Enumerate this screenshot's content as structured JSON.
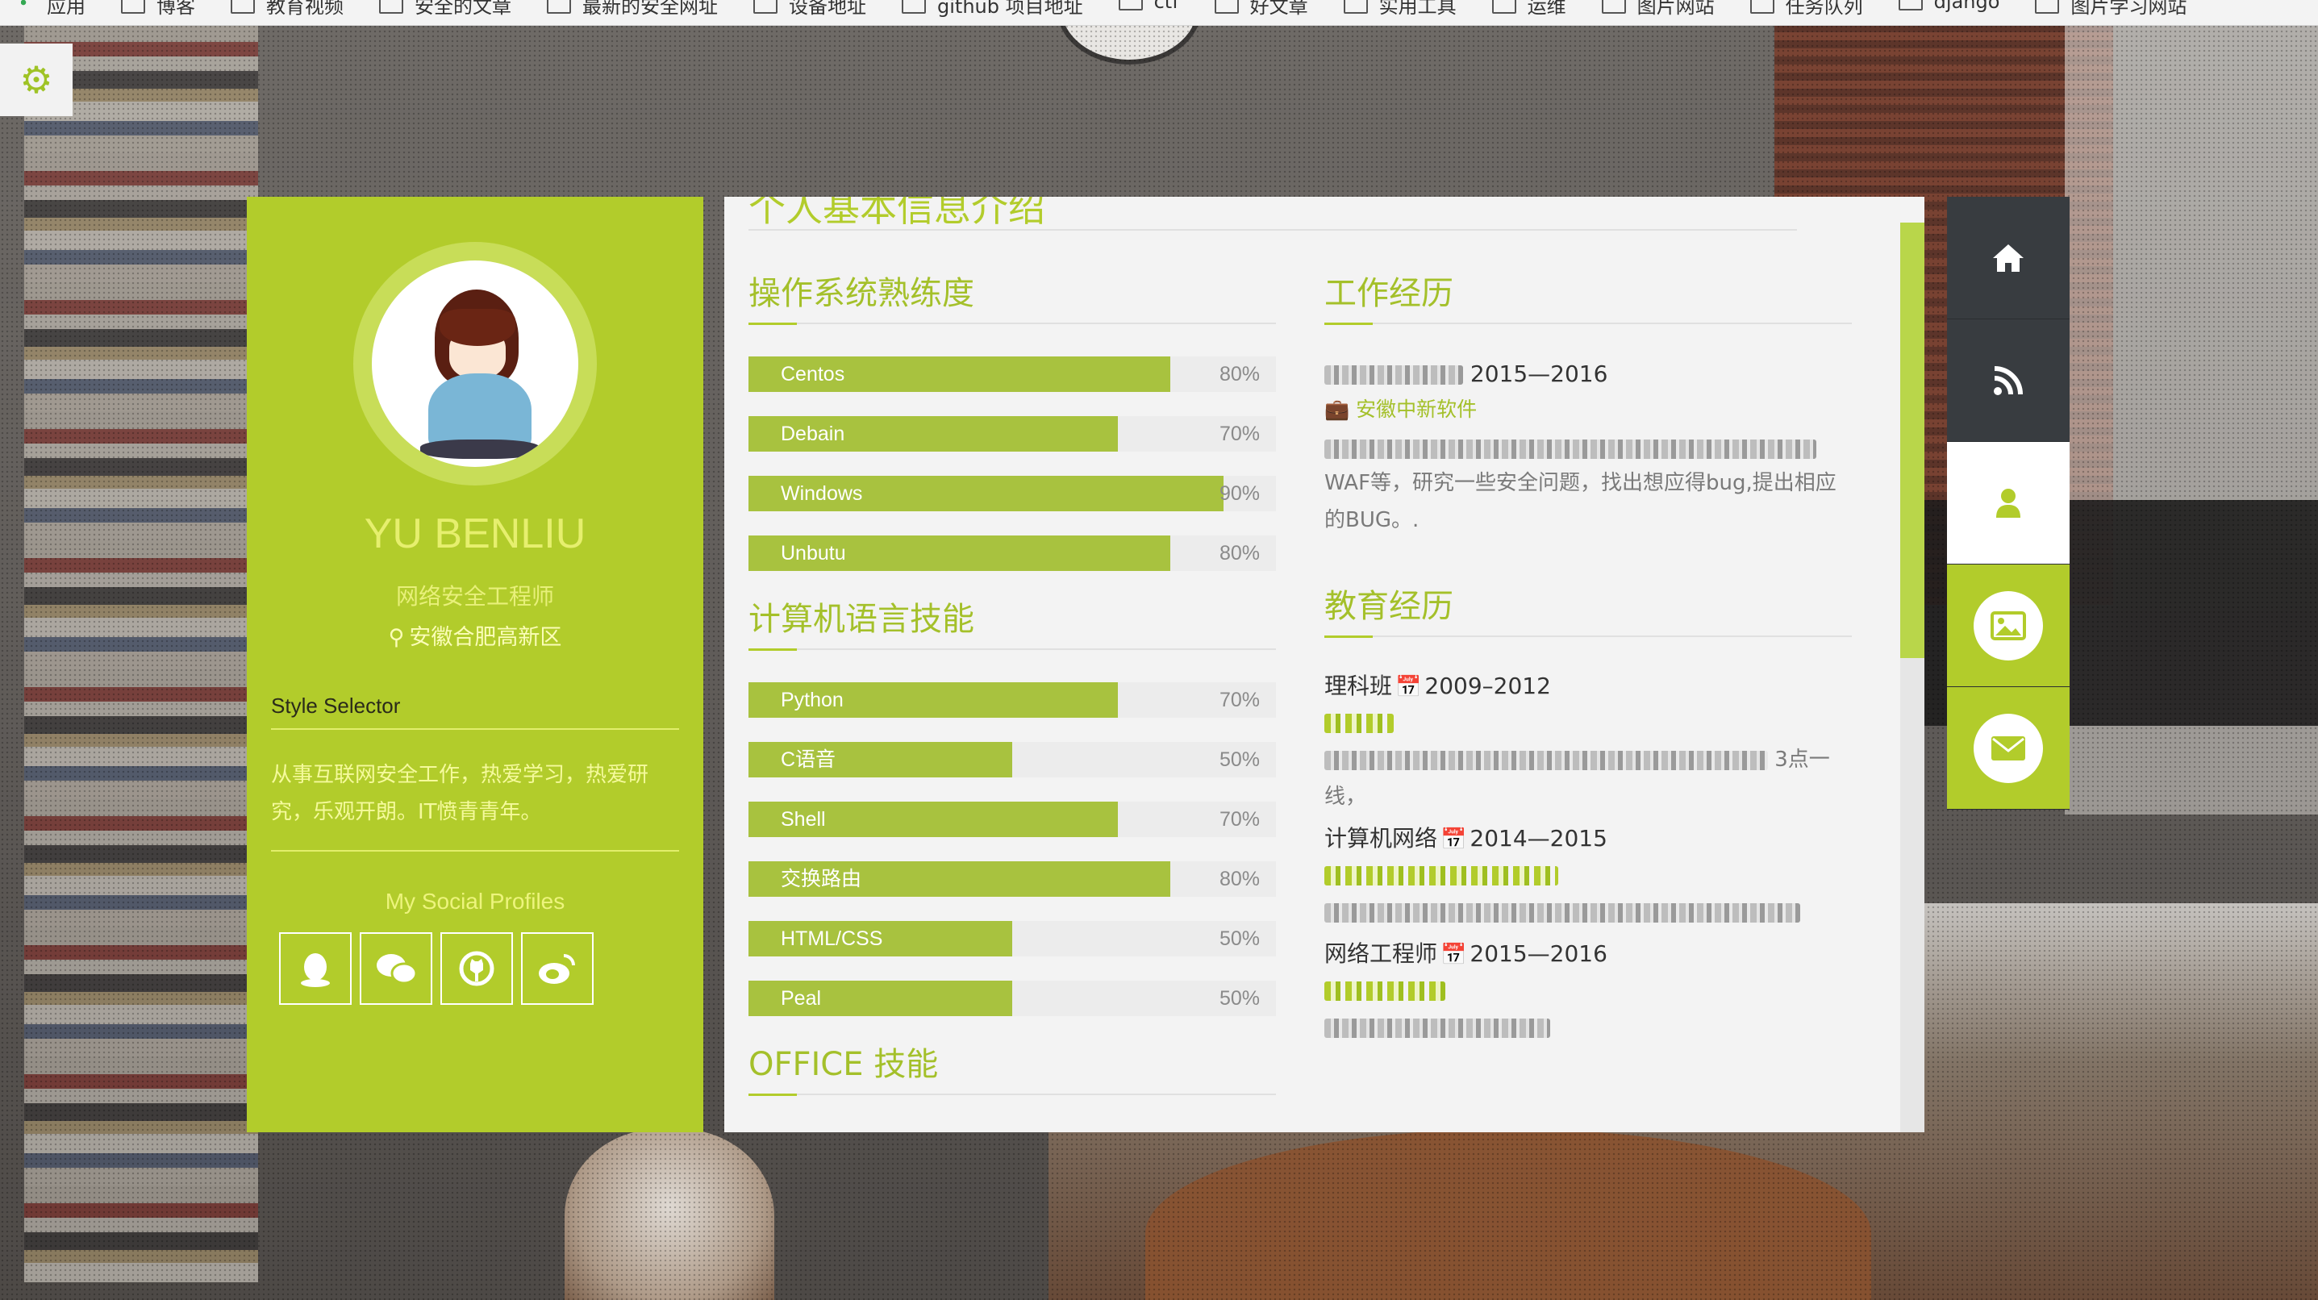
{
  "bookmarks_bar": {
    "items": [
      "应用",
      "博客",
      "教育视频",
      "安全的文章",
      "最新的安全网址",
      "设备地址",
      "github 项目地址",
      "ctf",
      "好文章",
      "实用工具",
      "运维",
      "图片网站",
      "任务队列",
      "django",
      "图片学习网站"
    ]
  },
  "settings": {
    "icon": "gear-icon"
  },
  "profile": {
    "name": "YU BENLIU",
    "title": "网络安全工程师",
    "location": "安徽合肥高新区",
    "style_selector": "Style Selector",
    "bio": "从事互联网安全工作，热爱学习，热爱研究，乐观开朗。IT愤青青年。",
    "social_title": "My Social Profiles",
    "social_icons": [
      "qq-icon",
      "wechat-icon",
      "github-icon",
      "weibo-icon"
    ],
    "accent_color": "#b2cc2b"
  },
  "main": {
    "top_partial_heading": "个人基本信息介绍",
    "os_section": {
      "title": "操作系统熟练度",
      "skills": [
        {
          "label": "Centos",
          "percent": "80%",
          "value": 80
        },
        {
          "label": "Debain",
          "percent": "70%",
          "value": 70
        },
        {
          "label": "Windows",
          "percent": "90%",
          "value": 90
        },
        {
          "label": "Unbutu",
          "percent": "80%",
          "value": 80
        }
      ]
    },
    "lang_section": {
      "title": "计算机语言技能",
      "skills": [
        {
          "label": "Python",
          "percent": "70%",
          "value": 70
        },
        {
          "label": "C语音",
          "percent": "50%",
          "value": 50
        },
        {
          "label": "Shell",
          "percent": "70%",
          "value": 70
        },
        {
          "label": "交换路由",
          "percent": "80%",
          "value": 80
        },
        {
          "label": "HTML/CSS",
          "percent": "50%",
          "value": 50
        },
        {
          "label": "Peal",
          "percent": "50%",
          "value": 50
        }
      ]
    },
    "office_section": {
      "title": "OFFICE 技能"
    },
    "work_section": {
      "title": "工作经历",
      "job_years": "2015—2016",
      "company": "安徽中新软件",
      "desc_visible": "WAF等，研究一些安全问题，找出想应得bug,提出相应的BUG。."
    },
    "edu_section": {
      "title": "教育经历",
      "items": [
        {
          "name": "理科班",
          "years": "2009–2012"
        },
        {
          "name": "计算机网络",
          "years": "2014—2015"
        },
        {
          "name": "网络工程师",
          "years": "2015—2016"
        }
      ],
      "detail_visible_fragment": "3点一线，"
    }
  },
  "right_nav": {
    "items": [
      "home-icon",
      "rss-icon",
      "user-icon",
      "image-icon",
      "envelope-icon"
    ],
    "active_index": 2
  }
}
